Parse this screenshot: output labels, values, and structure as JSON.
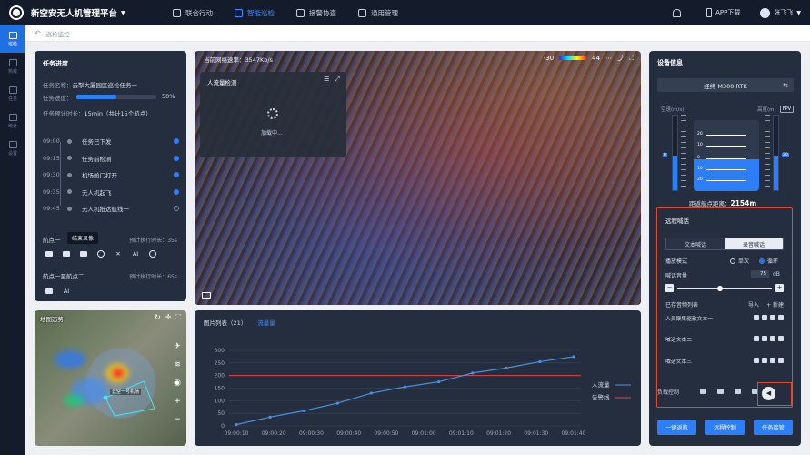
{
  "app": {
    "title": "新空安无人机管理平台"
  },
  "nav": [
    {
      "label": "联合行动",
      "active": false
    },
    {
      "label": "智能巡检",
      "active": true
    },
    {
      "label": "接警协查",
      "active": false
    },
    {
      "label": "通用管理",
      "active": false
    }
  ],
  "topright": {
    "app_download": "APP下载",
    "user": "张飞飞"
  },
  "rail": [
    {
      "label": "巡检",
      "active": true
    },
    {
      "label": "热线",
      "active": false
    },
    {
      "label": "任务",
      "active": false
    },
    {
      "label": "统计",
      "active": false
    },
    {
      "label": "设置",
      "active": false
    }
  ],
  "breadcrumb": {
    "text": "巡检监控"
  },
  "task": {
    "title": "任务进度",
    "name_label": "任务名称：",
    "name_value": "云掣大厦园区巡检任务一",
    "progress_label": "任务进度：",
    "progress": 0.5,
    "progress_text": "50%",
    "eta_label": "任务预计时长：",
    "eta_value": "15min（共计15个航点）",
    "timeline": [
      {
        "time": "09:00",
        "label": "任务已下发",
        "done": true
      },
      {
        "time": "09:15",
        "label": "任务前检测",
        "done": true
      },
      {
        "time": "09:30",
        "label": "机场舱门打开",
        "done": true
      },
      {
        "time": "09:35",
        "label": "无人机起飞",
        "done": true
      },
      {
        "time": "09:45",
        "label": "无人机抵达航线一",
        "done": false
      }
    ],
    "wp1_title": "航点一",
    "wp1_est": "预计执行时长：35s",
    "tooltip": "结束录像",
    "wp1_actions": [
      "",
      "",
      "",
      "",
      "",
      "AI",
      ""
    ],
    "wp2_title": "航点一至航点二",
    "wp2_est": "预计执行时长：65s",
    "wp2_actions": [
      "",
      "AI"
    ]
  },
  "map": {
    "title": "地图态势",
    "drone_label": "云空一号机场"
  },
  "video": {
    "network_rate": "当前网络速率：3547Kb/s",
    "colorbar_min": "-30",
    "colorbar_max": "44",
    "pfd_title": "人流量检测",
    "loading_text": "加载中..."
  },
  "chartpanel": {
    "tabs": [
      {
        "label": "图片列表（21）",
        "active": false
      },
      {
        "label": "流量量",
        "active": true
      }
    ]
  },
  "chart_data": {
    "type": "line",
    "categories": [
      "09:00:10",
      "09:00:20",
      "09:00:30",
      "09:00:40",
      "09:00:50",
      "09:01:00",
      "09:01:10",
      "09:01:20",
      "09:01:30",
      "09:01:40"
    ],
    "series": [
      {
        "name": "人流量",
        "values": [
          5,
          35,
          60,
          90,
          130,
          155,
          175,
          210,
          230,
          255,
          275
        ]
      },
      {
        "name": "告警线",
        "values": [
          200,
          200
        ]
      }
    ],
    "ylim": [
      0,
      300
    ],
    "yticks": [
      0,
      50,
      100,
      150,
      200,
      250,
      300
    ],
    "grid": true,
    "legend_position": "right",
    "colors": {
      "flow": "#4a90e2",
      "alarm": "#d9474b"
    }
  },
  "device": {
    "title": "设备信息",
    "model": "经纬 M300 RTK",
    "speed_label": "空速(m/s)",
    "alt_label": "高度(m)",
    "fpv": "FPV",
    "speed_value": "0",
    "alt_value": "20",
    "horizon_marks": [
      "20",
      "10",
      "0",
      "10",
      "20"
    ],
    "distance_label": "距返航点距离：",
    "distance_value": "2154m"
  },
  "shout": {
    "title": "远程喊话",
    "mode_text": "文本喊话",
    "mode_audio": "录音喊话",
    "play_mode_label": "播放模式",
    "single": "单次",
    "loop": "循环",
    "volume_label": "喊话音量",
    "volume_value": "75",
    "volume_unit": "dB",
    "volume": 0.45,
    "list_label": "已存音频列表",
    "import": "导入",
    "add": "+ 新建",
    "items": [
      "人员聚集驱散文本一",
      "喊话文本二",
      "喊话文本三"
    ]
  },
  "payload": {
    "label": "负载控制"
  },
  "buttons": {
    "return": "一键返航",
    "remote": "远程控制",
    "takeover": "任务接管"
  }
}
